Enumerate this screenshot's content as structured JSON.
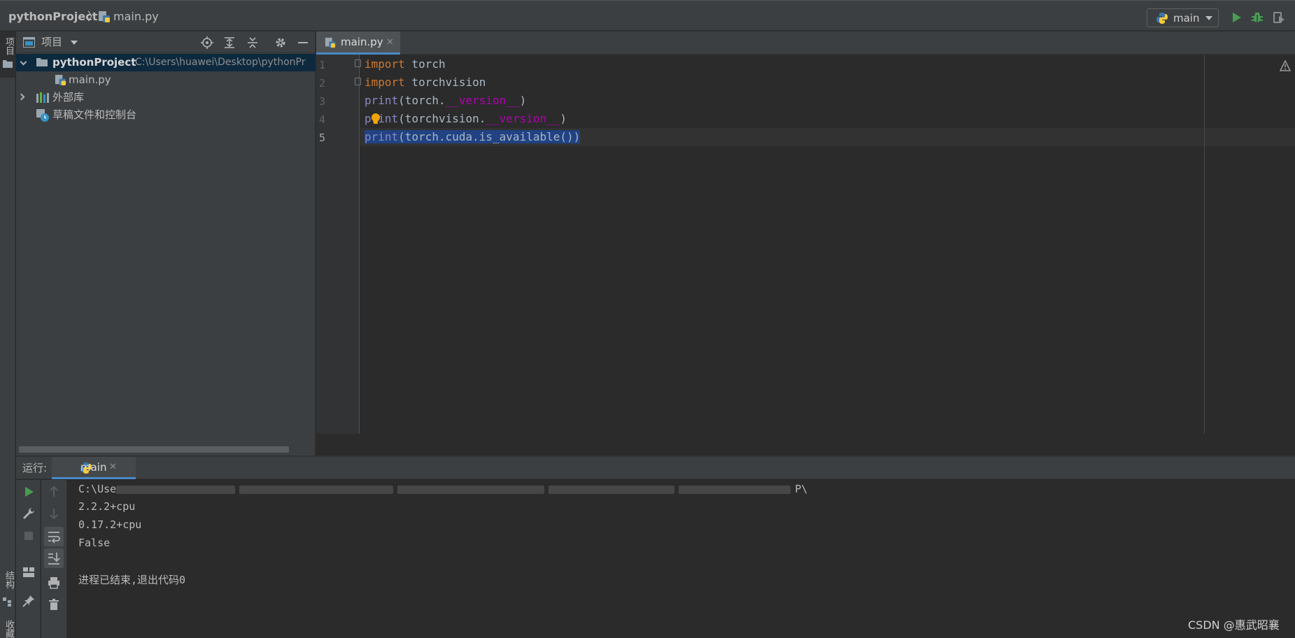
{
  "navbar": {
    "project": "pythonProject",
    "separator": "〉",
    "file": "main.py",
    "run_config": "main"
  },
  "left_strip": {
    "project_tab": "项目",
    "structure_tab": "结构",
    "favorites_tab": "收藏"
  },
  "project_panel": {
    "title": "项目",
    "tree": {
      "root_name": "pythonProject",
      "root_path": "C:\\Users\\huawei\\Desktop\\pythonPr",
      "file": "main.py",
      "external_libs": "外部库",
      "scratches": "草稿文件和控制台"
    }
  },
  "editor": {
    "tab": "main.py",
    "tab_close": "✕",
    "line_numbers": [
      "1",
      "2",
      "3",
      "4",
      "5"
    ],
    "code": {
      "l1_kw": "import",
      "l1_rest": " torch",
      "l2_kw": "import",
      "l2_rest": " torchvision",
      "l3_fn": "print",
      "l3_a": "(torch.",
      "l3_d": "__version__",
      "l3_b": ")",
      "l4_fn": "print",
      "l4_a": "(torchvision.",
      "l4_d": "__version__",
      "l4_b": ")",
      "l5_fn": "print",
      "l5_rest": "(torch.cuda.is_available())"
    }
  },
  "run_panel": {
    "label": "运行:",
    "tab": "main",
    "tab_close": "✕",
    "output": {
      "line1_prefix": "C:\\Use",
      "line1_tail": "P\\",
      "line2": "2.2.2+cpu",
      "line3": "0.17.2+cpu",
      "line4": "False",
      "line6": "进程已结束,退出代码0"
    }
  },
  "watermark": "CSDN @惠武昭襄",
  "colors": {
    "background": "#2b2b2b",
    "panel": "#3c3f41",
    "keyword": "#cc7832",
    "builtin": "#8888c6",
    "dunder": "#b200b2",
    "selection": "#214283",
    "accent": "#4a88c7",
    "run_green": "#499c54"
  }
}
